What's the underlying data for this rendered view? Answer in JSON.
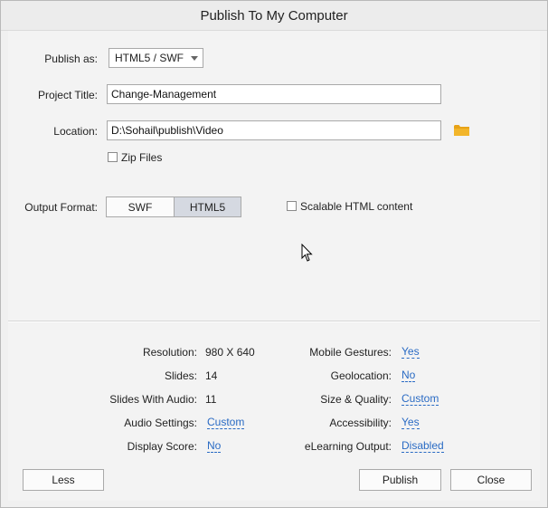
{
  "window": {
    "title": "Publish To My Computer"
  },
  "form": {
    "publish_as_label": "Publish as:",
    "publish_as_value": "HTML5 / SWF",
    "project_title_label": "Project Title:",
    "project_title_value": "Change-Management",
    "location_label": "Location:",
    "location_value": "D:\\Sohail\\publish\\Video",
    "zip_files_label": "Zip Files",
    "zip_files_checked": false,
    "output_format_label": "Output Format:",
    "output_formats": [
      "SWF",
      "HTML5"
    ],
    "output_format_selected": "HTML5",
    "scalable_label": "Scalable HTML content",
    "scalable_checked": false
  },
  "summary": {
    "left": [
      {
        "label": "Resolution:",
        "value": "980 X 640",
        "link": false
      },
      {
        "label": "Slides:",
        "value": "14",
        "link": false
      },
      {
        "label": "Slides With Audio:",
        "value": "11",
        "link": false
      },
      {
        "label": "Audio Settings:",
        "value": "Custom",
        "link": true
      },
      {
        "label": "Display Score:",
        "value": "No",
        "link": true
      }
    ],
    "right": [
      {
        "label": "Mobile Gestures:",
        "value": "Yes",
        "link": true
      },
      {
        "label": "Geolocation:",
        "value": "No",
        "link": true
      },
      {
        "label": "Size & Quality:",
        "value": "Custom",
        "link": true
      },
      {
        "label": "Accessibility:",
        "value": "Yes",
        "link": true
      },
      {
        "label": "eLearning Output:",
        "value": "Disabled",
        "link": true
      }
    ]
  },
  "buttons": {
    "less": "Less",
    "publish": "Publish",
    "close": "Close"
  },
  "colors": {
    "link": "#2a6bc4",
    "folder": "#e8a317",
    "selected_segment": "#d5d9e1"
  }
}
